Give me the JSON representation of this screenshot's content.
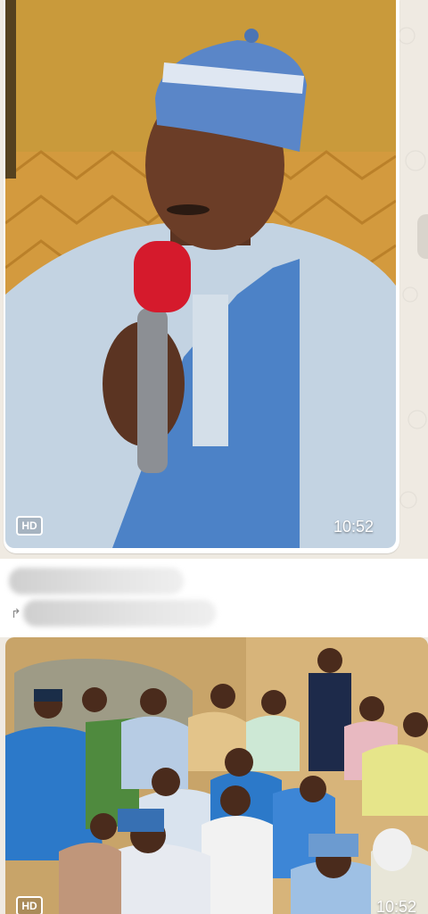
{
  "messages": [
    {
      "type": "image",
      "badge": "HD",
      "time": "10:52"
    },
    {
      "type": "text",
      "sender_redacted": true,
      "text_redacted": true
    },
    {
      "type": "image",
      "badge": "HD",
      "time": "10:52"
    }
  ],
  "colors": {
    "wallpaper": "#efeae2",
    "bubble": "#ffffff"
  }
}
